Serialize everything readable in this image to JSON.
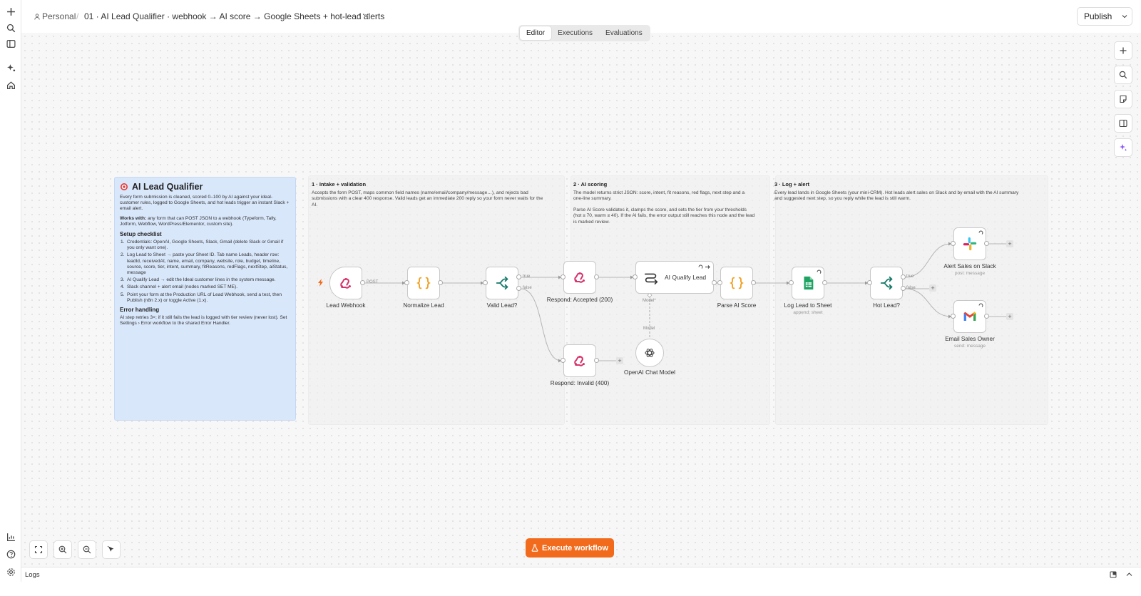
{
  "header": {
    "project": "Personal",
    "separator": "/",
    "workflow_title": "01 · AI Lead Qualifier · webhook → AI score → Google Sheets + hot-lead alerts",
    "more": "···",
    "publish_label": "Publish"
  },
  "tabs": [
    {
      "label": "Editor",
      "active": true
    },
    {
      "label": "Executions",
      "active": false
    },
    {
      "label": "Evaluations",
      "active": false
    }
  ],
  "notes": {
    "main": {
      "title": "AI Lead Qualifier",
      "intro": "Every form submission is cleaned, scored 0–100 by AI against your ideal-customer rules, logged to Google Sheets, and hot leads trigger an instant Slack + email alert.",
      "works_with_label": "Works with:",
      "works_with": "any form that can POST JSON to a webhook (Typeform, Tally, Jotform, Webflow, WordPress/Elementor, custom site).",
      "setup_heading": "Setup checklist",
      "steps": [
        "Credentials: OpenAI, Google Sheets, Slack, Gmail (delete Slack or Gmail if you only want one).",
        "Log Lead to Sheet → paste your Sheet ID. Tab name Leads, header row: leadId, receivedAt, name, email, company, website, role, budget, timeline, source, score, tier, intent, summary, fitReasons, redFlags, nextStep, aiStatus, message",
        "AI Qualify Lead → edit the Ideal customer lines in the system message.",
        "Slack channel + alert email (nodes marked SET ME).",
        "Point your form at the Production URL of Lead Webhook, send a test, then Publish (n8n 2.x) or toggle Active (1.x)."
      ],
      "error_heading": "Error handling",
      "error_text": "AI step retries 3×; if it still fails the lead is logged with tier review (never lost). Set Settings › Error workflow to the shared Error Handler."
    },
    "intake": {
      "title": "1 · Intake + validation",
      "text": "Accepts the form POST, maps common field names (name/email/company/message…), and rejects bad submissions with a clear 400 response. Valid leads get an immediate 200 reply so your form never waits for the AI."
    },
    "scoring": {
      "title": "2 · AI scoring",
      "text1": "The model returns strict JSON: score, intent, fit reasons, red flags, next step and a one-line summary.",
      "text2": "Parse AI Score validates it, clamps the score, and sets the tier from your thresholds (hot ≥ 70, warm ≥ 40). If the AI fails, the error output still reaches this node and the lead is marked review."
    },
    "log": {
      "title": "3 · Log + alert",
      "text": "Every lead lands in Google Sheets (your mini-CRM). Hot leads alert sales on Slack and by email with the AI summary and suggested next step, so you reply while the lead is still warm."
    }
  },
  "nodes": {
    "lead_webhook": {
      "label": "Lead Webhook",
      "icon": "webhook-icon"
    },
    "normalize_lead": {
      "label": "Normalize Lead",
      "icon": "code-braces-icon"
    },
    "valid_lead": {
      "label": "Valid Lead?",
      "icon": "if-branch-icon"
    },
    "respond_accepted": {
      "label": "Respond: Accepted (200)",
      "icon": "webhook-icon"
    },
    "respond_invalid": {
      "label": "Respond: Invalid (400)",
      "icon": "webhook-icon"
    },
    "ai_qualify": {
      "label": "AI Qualify Lead",
      "icon": "ai-agent-icon"
    },
    "openai_model": {
      "label": "OpenAI Chat Model",
      "icon": "openai-icon"
    },
    "parse_score": {
      "label": "Parse AI Score",
      "icon": "code-braces-icon"
    },
    "log_sheet": {
      "label": "Log Lead to Sheet",
      "sub": "append: sheet",
      "icon": "google-sheets-icon"
    },
    "hot_lead": {
      "label": "Hot Lead?",
      "icon": "if-branch-icon"
    },
    "alert_slack": {
      "label": "Alert Sales on Slack",
      "sub": "post: message",
      "icon": "slack-icon"
    },
    "email_owner": {
      "label": "Email Sales Owner",
      "sub": "send: message",
      "icon": "gmail-icon"
    }
  },
  "edges": {
    "post": "POST",
    "true1": "true",
    "false1": "false",
    "model_star": "Model*",
    "model": "Model",
    "true2": "true",
    "false2": "false"
  },
  "toolbar": {
    "execute_label": "Execute workflow"
  },
  "logs": {
    "label": "Logs"
  },
  "colors": {
    "accent": "#f26b1d",
    "sticky_blue": "#d9e7fb",
    "webhook": "#d6336c",
    "code": "#f0a020",
    "if": "#167a6a"
  }
}
